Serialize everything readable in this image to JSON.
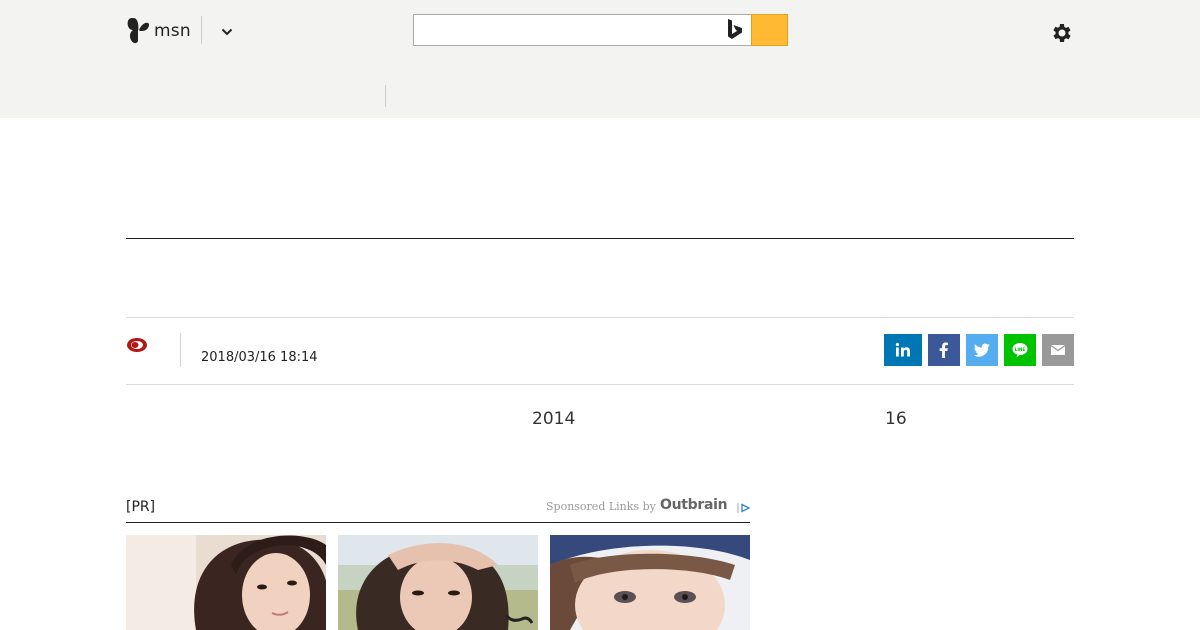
{
  "header": {
    "logo_text": "msn",
    "search": {
      "value": "",
      "placeholder": ""
    }
  },
  "article": {
    "timestamp": "2018/03/16 18:14",
    "body_numbers": [
      "2014",
      "16"
    ]
  },
  "share": [
    {
      "name": "linkedin",
      "color": "#0077b5"
    },
    {
      "name": "facebook",
      "color": "#3b5998"
    },
    {
      "name": "twitter",
      "color": "#55acee"
    },
    {
      "name": "line",
      "color": "#00c300"
    },
    {
      "name": "email",
      "color": "#999999"
    }
  ],
  "sponsored": {
    "pr_label": "[PR]",
    "by_text": "Sponsored Links by",
    "brand": "Outbrain"
  },
  "colors": {
    "header_bg": "#f3f3f2",
    "search_button": "#ffb933",
    "source_icon": "#b01818"
  }
}
